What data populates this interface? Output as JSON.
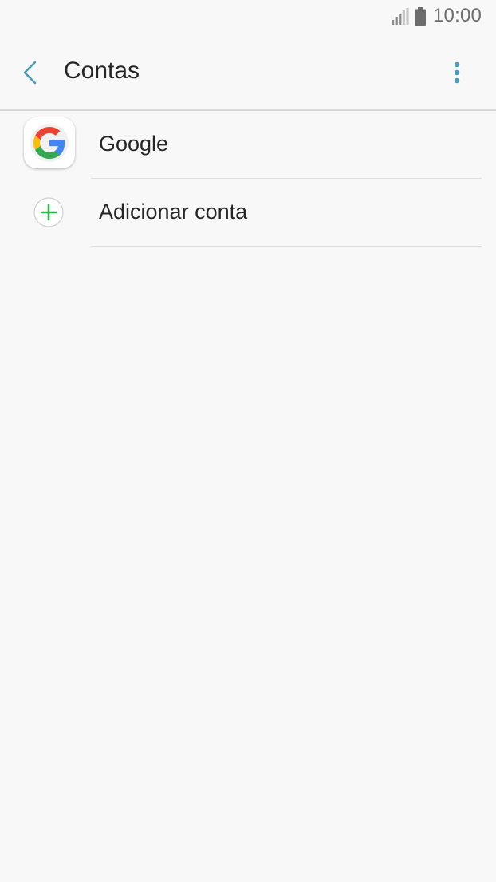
{
  "status_bar": {
    "time": "10:00",
    "icons": [
      "signal-icon",
      "battery-icon"
    ]
  },
  "app_bar": {
    "title": "Contas",
    "back_icon": "chevron-left-icon",
    "menu_icon": "more-vert-icon",
    "accent_color": "#4a9bb5"
  },
  "accounts": {
    "items": [
      {
        "label": "Google",
        "icon": "google-icon"
      },
      {
        "label": "Adicionar conta",
        "icon": "add-circle-icon",
        "icon_color": "#2fb34a"
      }
    ]
  }
}
